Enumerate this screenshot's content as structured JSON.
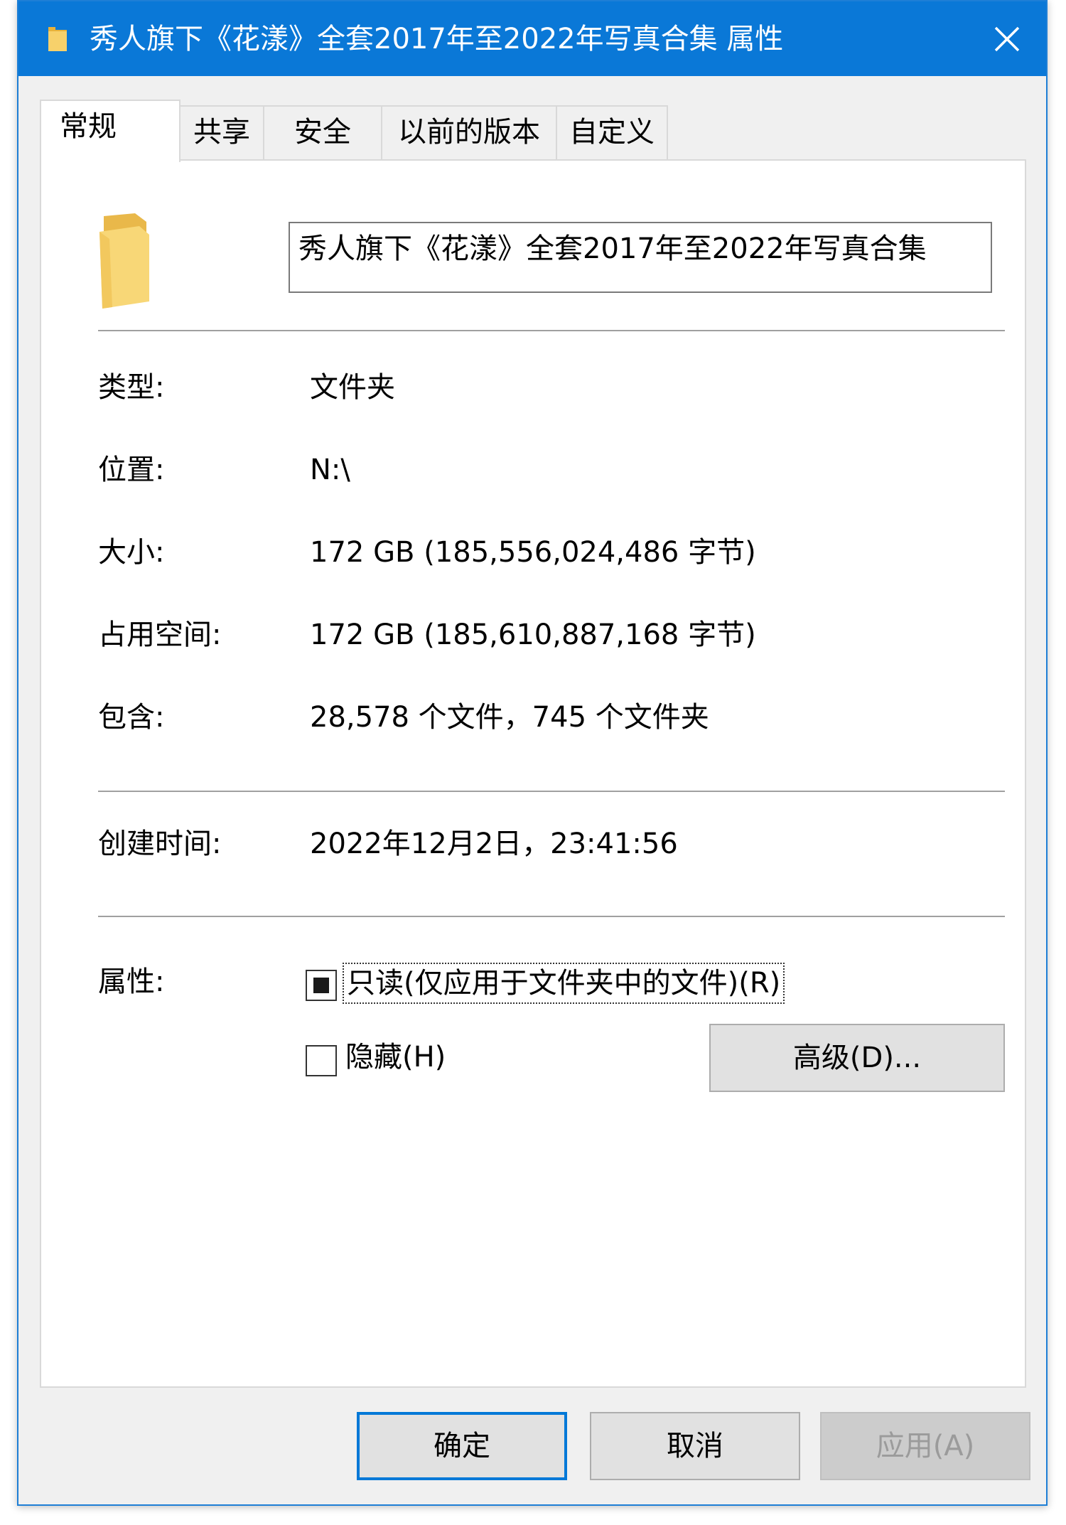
{
  "window": {
    "title": "秀人旗下《花漾》全套2017年至2022年写真合集 属性"
  },
  "tabs": [
    {
      "label": "常规",
      "active": true
    },
    {
      "label": "共享"
    },
    {
      "label": "安全"
    },
    {
      "label": "以前的版本"
    },
    {
      "label": "自定义"
    }
  ],
  "general": {
    "folder_name": "秀人旗下《花漾》全套2017年至2022年写真合集",
    "type_label": "类型:",
    "type_value": "文件夹",
    "location_label": "位置:",
    "location_value": "N:\\",
    "size_label": "大小:",
    "size_value": "172 GB (185,556,024,486 字节)",
    "size_on_disk_label": "占用空间:",
    "size_on_disk_value": "172 GB (185,610,887,168 字节)",
    "contains_label": "包含:",
    "contains_value": "28,578 个文件，745 个文件夹",
    "created_label": "创建时间:",
    "created_value": "2022年12月2日，23:41:56",
    "attributes_label": "属性:",
    "readonly_label": "只读(仅应用于文件夹中的文件)(R)",
    "readonly_state": "indeterminate",
    "hidden_label": "隐藏(H)",
    "hidden_checked": false,
    "advanced_label": "高级(D)..."
  },
  "footer": {
    "ok_label": "确定",
    "cancel_label": "取消",
    "apply_label": "应用(A)",
    "apply_disabled": true
  },
  "colors": {
    "titlebar": "#0a78d7",
    "folder": "#f4c55a",
    "accent": "#0078d7"
  },
  "icons": {
    "title": "folder-icon",
    "close": "close-icon",
    "main": "folder-icon"
  }
}
